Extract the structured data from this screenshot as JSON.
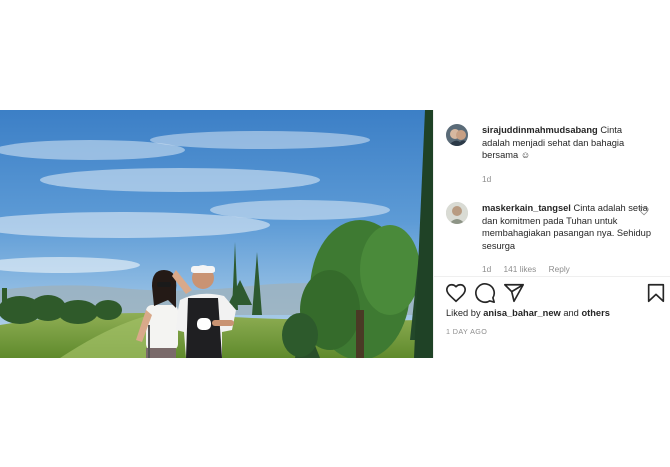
{
  "caption": {
    "username": "sirajuddinmahmudsabang",
    "text": "Cinta adalah menjadi sehat dan bahagia bersama ☺",
    "age": "1d"
  },
  "comment": {
    "username": "maskerkain_tangsel",
    "text": "Cinta adalah setia dan komitmen pada Tuhan untuk membahagiakan pasangan nya. Sehidup sesurga",
    "age": "1d",
    "likes": "141 likes",
    "reply": "Reply"
  },
  "liked_by": {
    "prefix": "Liked by",
    "user": "anisa_bahar_new",
    "connector": "and",
    "others": "others"
  },
  "posted": "1 DAY AGO",
  "icons": {
    "like": "heart-icon",
    "comment": "comment-icon",
    "share": "send-icon",
    "save": "bookmark-icon",
    "comment_like": "heart-icon"
  }
}
